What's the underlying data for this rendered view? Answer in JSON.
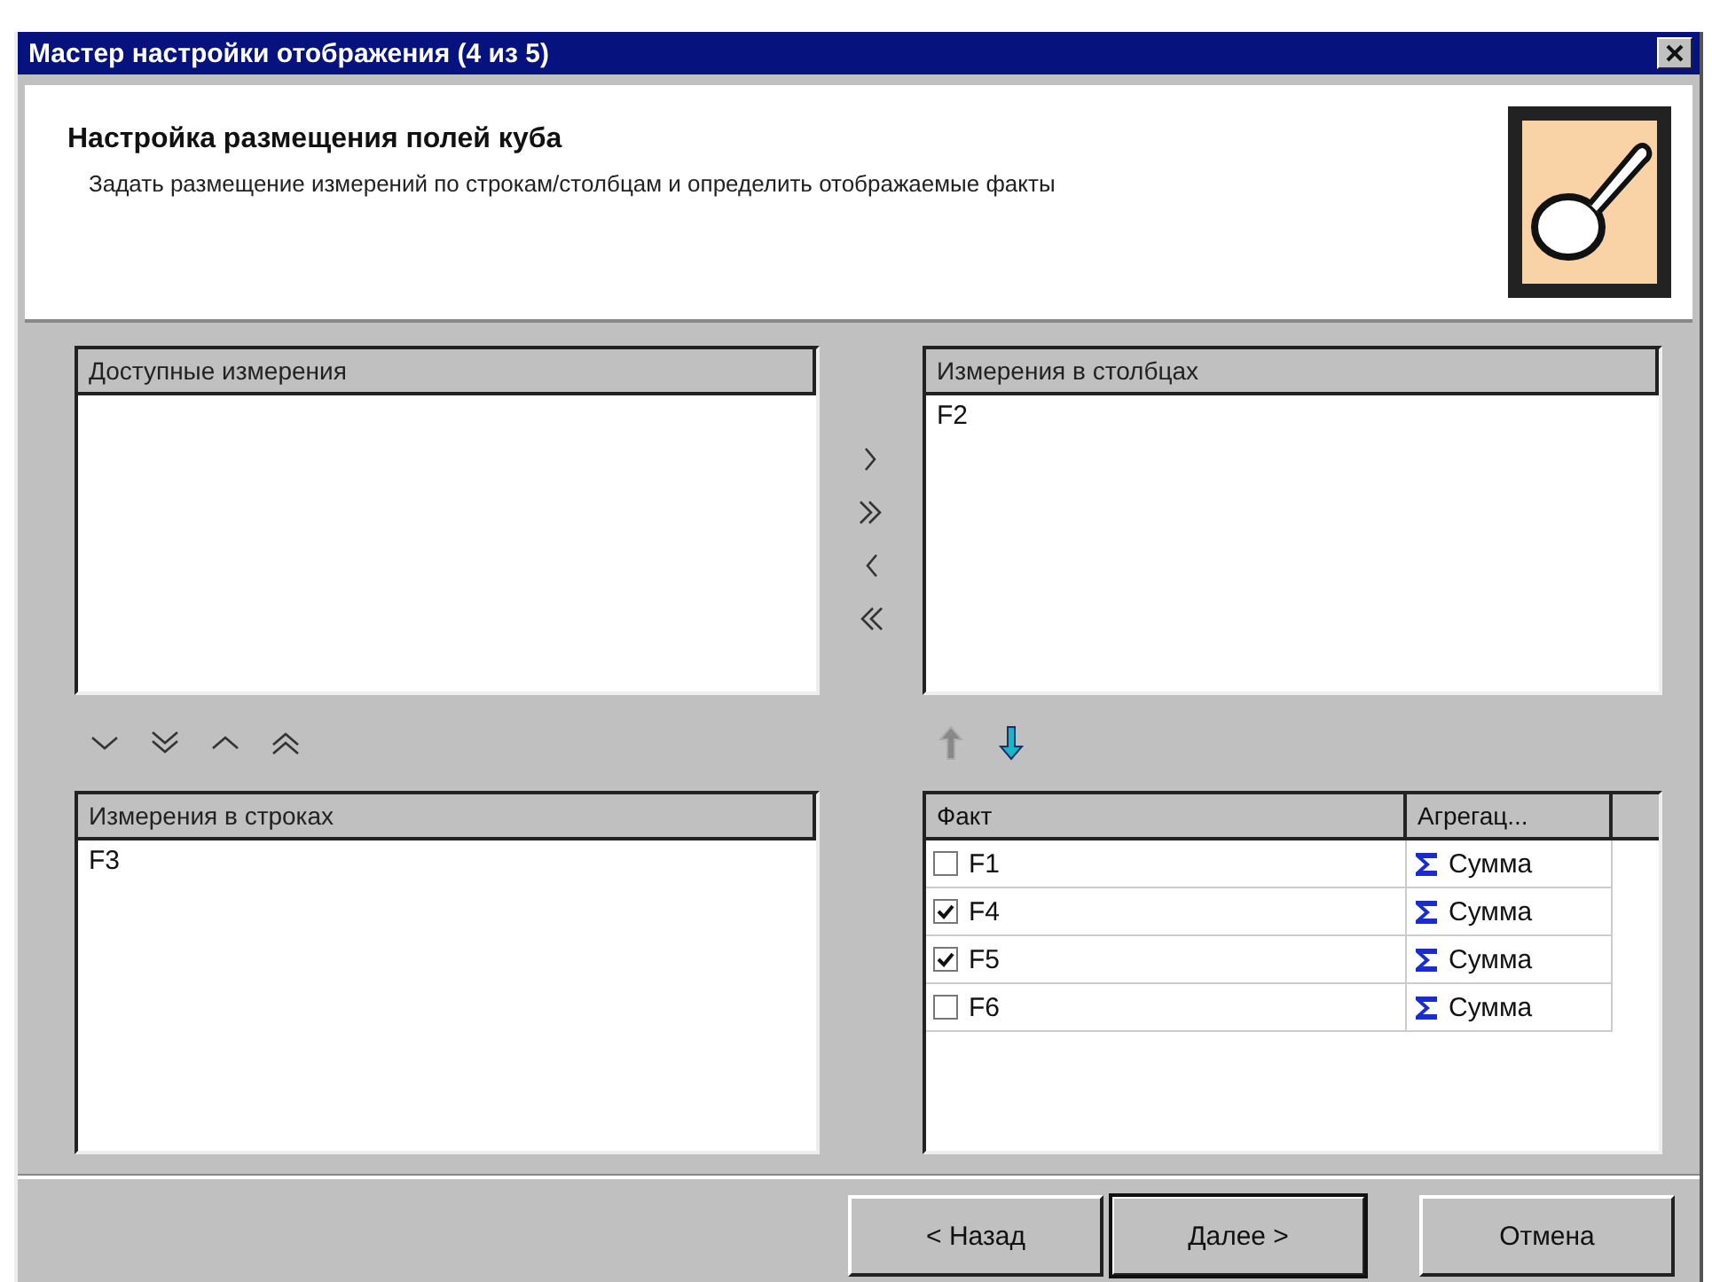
{
  "window": {
    "title": "Мастер настройки отображения (4 из 5)"
  },
  "header": {
    "title": "Настройка размещения полей куба",
    "description": "Задать размещение измерений по строкам/столбцам и определить отображаемые факты"
  },
  "available": {
    "heading": "Доступные измерения"
  },
  "columns": {
    "heading": "Измерения в столбцах",
    "items": [
      "F2"
    ]
  },
  "move_buttons": [
    {
      "kind": "right"
    },
    {
      "kind": "all-right"
    },
    {
      "kind": "left"
    },
    {
      "kind": "all-left"
    }
  ],
  "order_buttons": [
    {
      "kind": "down"
    },
    {
      "kind": "bottom"
    },
    {
      "kind": "up"
    },
    {
      "kind": "top"
    }
  ],
  "rows": {
    "heading": "Измерения в строках",
    "items": [
      "F3"
    ]
  },
  "fact_order_buttons": [
    {
      "kind": "up",
      "disabled": true
    },
    {
      "kind": "down",
      "disabled": false
    }
  ],
  "facts": {
    "columns": [
      "Факт",
      "Агрегац..."
    ],
    "rows": [
      {
        "name": "F1",
        "checked": false,
        "aggregation": "Сумма"
      },
      {
        "name": "F4",
        "checked": true,
        "aggregation": "Сумма"
      },
      {
        "name": "F5",
        "checked": true,
        "aggregation": "Сумма"
      },
      {
        "name": "F6",
        "checked": false,
        "aggregation": "Сумма"
      }
    ]
  },
  "buttons": [
    {
      "label": "< Назад",
      "default": false
    },
    {
      "label": "Далее >",
      "default": true
    },
    {
      "label": "Отмена",
      "default": false
    }
  ]
}
